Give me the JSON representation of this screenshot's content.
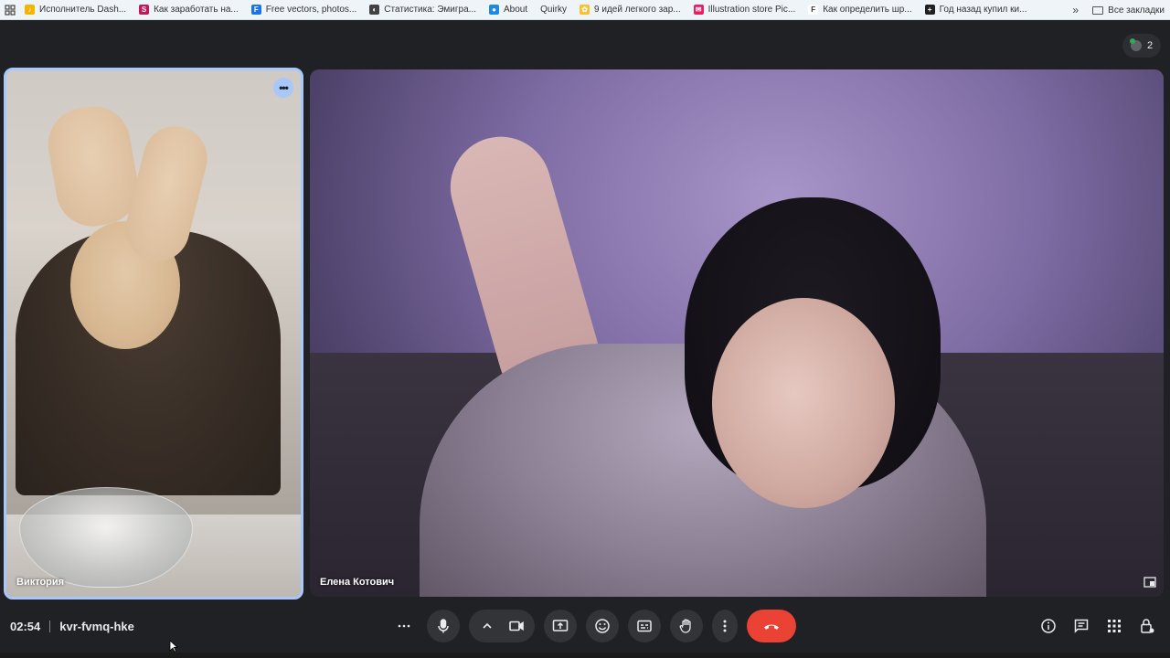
{
  "bookmarks": {
    "items": [
      {
        "label": "Исполнитель Dash...",
        "color": "#f4b400",
        "glyph": "♪"
      },
      {
        "label": "Как заработать на...",
        "color": "#c2185b",
        "glyph": "S"
      },
      {
        "label": "Free vectors, photos...",
        "color": "#1a73e8",
        "glyph": "F"
      },
      {
        "label": "Статистика: Эмигра...",
        "color": "#424242",
        "glyph": "◐"
      },
      {
        "label": "About",
        "color": "#1e88e5",
        "glyph": "●"
      },
      {
        "label": "Quirky",
        "color": "transparent",
        "glyph": ""
      },
      {
        "label": "9 идей легкого зар...",
        "color": "#fbc02d",
        "glyph": "✿"
      },
      {
        "label": "Illustration store Pic...",
        "color": "#e91e63",
        "glyph": "✉"
      },
      {
        "label": "Как определить шр...",
        "color": "#ffffff",
        "glyph": "F"
      },
      {
        "label": "Год назад купил ки...",
        "color": "#212121",
        "glyph": "+"
      }
    ],
    "more_label": "»",
    "all_bookmarks_label": "Все закладки"
  },
  "meeting": {
    "participant_count": "2",
    "time": "02:54",
    "code": "kvr-fvmq-hke"
  },
  "participants": {
    "left_name": "Виктория",
    "right_name": "Елена Котович"
  },
  "colors": {
    "end_call": "#ea4335",
    "active_border": "#a8c7fa",
    "background": "#202124"
  }
}
